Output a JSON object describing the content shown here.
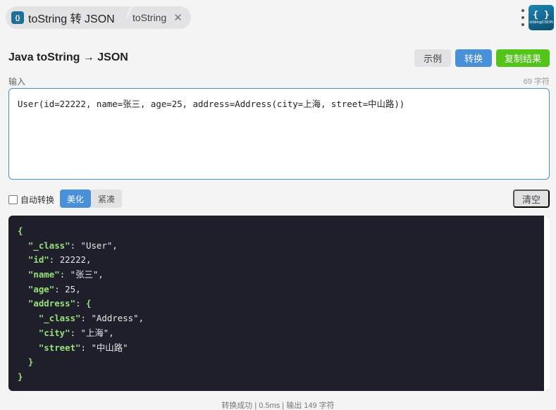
{
  "tabs": {
    "main_label": "toString 转 JSON",
    "second_label": "toString",
    "close_glyph": "✕"
  },
  "logo": {
    "glyph": "{ }",
    "text": "toString2JSON"
  },
  "header": {
    "title": "Java toString → JSON",
    "example_label": "示例",
    "convert_label": "转换",
    "copy_label": "复制结果"
  },
  "input": {
    "label": "输入",
    "char_count": "69 字符",
    "value": "User(id=22222, name=张三, age=25, address=Address(city=上海, street=中山路))"
  },
  "options": {
    "auto_convert_label": "自动转换",
    "auto_convert_checked": false,
    "beautify_label": "美化",
    "compact_label": "紧凑",
    "clear_label": "清空"
  },
  "output": {
    "lines": [
      [
        {
          "t": "{",
          "c": "k"
        }
      ],
      [
        {
          "t": "  \"_class\"",
          "c": "k"
        },
        {
          "t": ": ",
          "c": "p"
        },
        {
          "t": "\"User\"",
          "c": "s"
        },
        {
          "t": ",",
          "c": "p"
        }
      ],
      [
        {
          "t": "  \"id\"",
          "c": "k"
        },
        {
          "t": ": ",
          "c": "p"
        },
        {
          "t": "22222",
          "c": "n"
        },
        {
          "t": ",",
          "c": "p"
        }
      ],
      [
        {
          "t": "  \"name\"",
          "c": "k"
        },
        {
          "t": ": ",
          "c": "p"
        },
        {
          "t": "\"张三\"",
          "c": "s"
        },
        {
          "t": ",",
          "c": "p"
        }
      ],
      [
        {
          "t": "  \"age\"",
          "c": "k"
        },
        {
          "t": ": ",
          "c": "p"
        },
        {
          "t": "25",
          "c": "n"
        },
        {
          "t": ",",
          "c": "p"
        }
      ],
      [
        {
          "t": "  \"address\"",
          "c": "k"
        },
        {
          "t": ": ",
          "c": "p"
        },
        {
          "t": "{",
          "c": "k"
        }
      ],
      [
        {
          "t": "    \"_class\"",
          "c": "k"
        },
        {
          "t": ": ",
          "c": "p"
        },
        {
          "t": "\"Address\"",
          "c": "s"
        },
        {
          "t": ",",
          "c": "p"
        }
      ],
      [
        {
          "t": "    \"city\"",
          "c": "k"
        },
        {
          "t": ": ",
          "c": "p"
        },
        {
          "t": "\"上海\"",
          "c": "s"
        },
        {
          "t": ",",
          "c": "p"
        }
      ],
      [
        {
          "t": "    \"street\"",
          "c": "k"
        },
        {
          "t": ": ",
          "c": "p"
        },
        {
          "t": "\"中山路\"",
          "c": "s"
        }
      ],
      [
        {
          "t": "  }",
          "c": "k"
        }
      ],
      [
        {
          "t": "}",
          "c": "k"
        }
      ]
    ]
  },
  "status": "转换成功 | 0.5ms | 输出 149 字符",
  "colors": {
    "accent_blue": "#4a90d9",
    "success_green": "#52c41a",
    "json_key_green": "#98e07a",
    "code_background": "#1f1f2b"
  }
}
